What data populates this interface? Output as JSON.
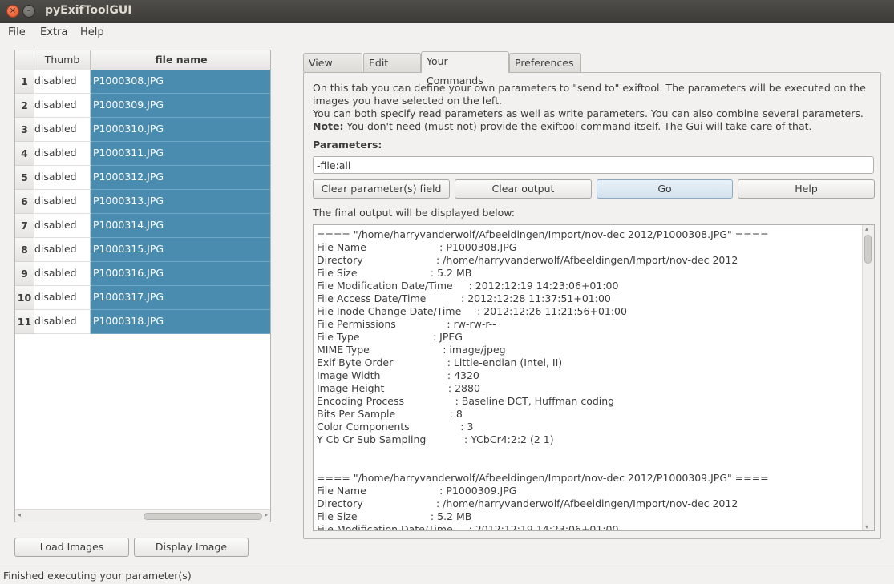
{
  "window": {
    "title": "pyExifToolGUI",
    "close_glyph": "×",
    "min_glyph": "–"
  },
  "menu": {
    "file": "File",
    "extra": "Extra",
    "help": "Help"
  },
  "table": {
    "headers": {
      "thumb": "Thumb",
      "filename": "file name"
    },
    "rows": [
      {
        "num": "1",
        "thumb": "disabled",
        "file": "P1000308.JPG"
      },
      {
        "num": "2",
        "thumb": "disabled",
        "file": "P1000309.JPG"
      },
      {
        "num": "3",
        "thumb": "disabled",
        "file": "P1000310.JPG"
      },
      {
        "num": "4",
        "thumb": "disabled",
        "file": "P1000311.JPG"
      },
      {
        "num": "5",
        "thumb": "disabled",
        "file": "P1000312.JPG"
      },
      {
        "num": "6",
        "thumb": "disabled",
        "file": "P1000313.JPG"
      },
      {
        "num": "7",
        "thumb": "disabled",
        "file": "P1000314.JPG"
      },
      {
        "num": "8",
        "thumb": "disabled",
        "file": "P1000315.JPG"
      },
      {
        "num": "9",
        "thumb": "disabled",
        "file": "P1000316.JPG"
      },
      {
        "num": "10",
        "thumb": "disabled",
        "file": "P1000317.JPG"
      },
      {
        "num": "11",
        "thumb": "disabled",
        "file": "P1000318.JPG"
      }
    ]
  },
  "left_buttons": {
    "load": "Load Images",
    "display": "Display Image"
  },
  "tabs": {
    "view": "View Data",
    "edit": "Edit Data",
    "commands": "Your Commands",
    "prefs": "Preferences"
  },
  "commands": {
    "desc1": "On this tab you can define your own parameters to \"send to\" exiftool. The parameters will be executed on the images you have selected on the left.",
    "desc2": "You can both specify read parameters as well as write parameters. You can also combine several parameters.",
    "note_label": "Note:",
    "desc3": "You don't need (must not) provide the exiftool command itself. The Gui will take care of that.",
    "parameters_label": "Parameters:",
    "parameters_value": "-file:all",
    "btn_clear_params": "Clear parameter(s) field",
    "btn_clear_output": "Clear output",
    "btn_go": "Go",
    "btn_help": "Help",
    "output_label": "The final output will be displayed below:",
    "output_text": "==== \"/home/harryvanderwolf/Afbeeldingen/Import/nov-dec 2012/P1000308.JPG\" ====\nFile Name                       : P1000308.JPG\nDirectory                       : /home/harryvanderwolf/Afbeeldingen/Import/nov-dec 2012\nFile Size                       : 5.2 MB\nFile Modification Date/Time     : 2012:12:19 14:23:06+01:00\nFile Access Date/Time           : 2012:12:28 11:37:51+01:00\nFile Inode Change Date/Time     : 2012:12:26 11:21:56+01:00\nFile Permissions                : rw-rw-r--\nFile Type                       : JPEG\nMIME Type                       : image/jpeg\nExif Byte Order                 : Little-endian (Intel, II)\nImage Width                     : 4320\nImage Height                    : 2880\nEncoding Process                : Baseline DCT, Huffman coding\nBits Per Sample                 : 8\nColor Components                : 3\nY Cb Cr Sub Sampling            : YCbCr4:2:2 (2 1)\n\n\n==== \"/home/harryvanderwolf/Afbeeldingen/Import/nov-dec 2012/P1000309.JPG\" ====\nFile Name                       : P1000309.JPG\nDirectory                       : /home/harryvanderwolf/Afbeeldingen/Import/nov-dec 2012\nFile Size                       : 5.2 MB\nFile Modification Date/Time     : 2012:12:19 14:23:06+01:00"
  },
  "status": "Finished executing your parameter(s)",
  "colors": {
    "selection": "#4a8cb0",
    "titlebar": "#3c3b37",
    "close_button": "#e0501f"
  }
}
